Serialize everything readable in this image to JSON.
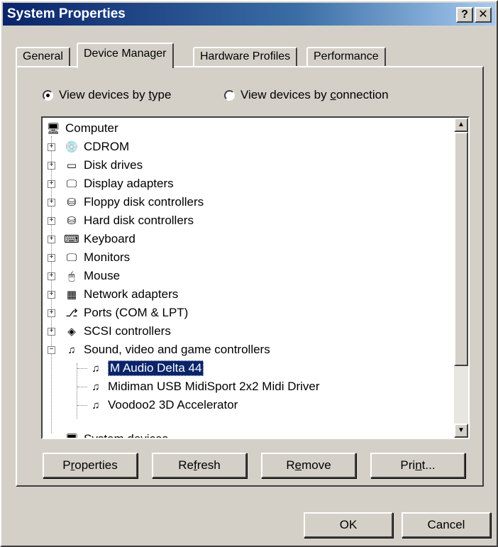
{
  "window": {
    "title": "System Properties",
    "help_button": "?",
    "close_button": "✕"
  },
  "tabs": [
    {
      "label": "General"
    },
    {
      "label": "Device Manager"
    },
    {
      "label": "Hardware Profiles"
    },
    {
      "label": "Performance"
    }
  ],
  "view_options": {
    "by_type": {
      "pre": "View devices by ",
      "key": "t",
      "post": "ype",
      "checked": true
    },
    "by_connection": {
      "pre": "View devices by ",
      "key": "c",
      "post": "onnection",
      "checked": false
    }
  },
  "tree": {
    "root": "Computer",
    "items": [
      {
        "label": "CDROM",
        "icon": "cdrom-icon",
        "expander": "+"
      },
      {
        "label": "Disk drives",
        "icon": "disk-drive-icon",
        "expander": "+"
      },
      {
        "label": "Display adapters",
        "icon": "display-adapter-icon",
        "expander": "+"
      },
      {
        "label": "Floppy disk controllers",
        "icon": "floppy-controller-icon",
        "expander": "+"
      },
      {
        "label": "Hard disk controllers",
        "icon": "hard-disk-controller-icon",
        "expander": "+"
      },
      {
        "label": "Keyboard",
        "icon": "keyboard-icon",
        "expander": "+"
      },
      {
        "label": "Monitors",
        "icon": "monitor-icon",
        "expander": "+"
      },
      {
        "label": "Mouse",
        "icon": "mouse-icon",
        "expander": "+"
      },
      {
        "label": "Network adapters",
        "icon": "network-adapter-icon",
        "expander": "+"
      },
      {
        "label": "Ports (COM & LPT)",
        "icon": "ports-icon",
        "expander": "+"
      },
      {
        "label": "SCSI controllers",
        "icon": "scsi-icon",
        "expander": "+"
      },
      {
        "label": "Sound, video and game controllers",
        "icon": "sound-controller-icon",
        "expander": "−"
      }
    ],
    "children": [
      {
        "label": "M Audio Delta 44",
        "selected": true
      },
      {
        "label": "Midiman USB MidiSport 2x2 Midi Driver",
        "selected": false
      },
      {
        "label": "Voodoo2 3D Accelerator",
        "selected": false
      }
    ],
    "partial": "System devices"
  },
  "buttons": {
    "properties": {
      "pre": "P",
      "key": "r",
      "post": "operties"
    },
    "refresh": {
      "pre": "Re",
      "key": "f",
      "post": "resh"
    },
    "remove": {
      "pre": "R",
      "key": "e",
      "post": "move"
    },
    "print": {
      "pre": "Pri",
      "key": "n",
      "post": "t..."
    },
    "ok": "OK",
    "cancel": "Cancel"
  }
}
